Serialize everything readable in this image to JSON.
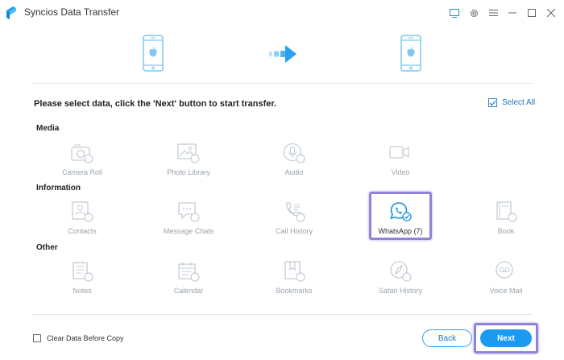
{
  "window": {
    "title": "Syncios Data Transfer",
    "accent_color": "#1a9af0",
    "highlight_color": "#9184d8"
  },
  "header_icons": [
    "feedback-icon",
    "gear-icon",
    "menu-icon",
    "minimize-icon",
    "maximize-icon",
    "close-icon"
  ],
  "instruction": "Please select data, click the 'Next' button to start transfer.",
  "select_all_label": "Select All",
  "sections": {
    "media": {
      "title": "Media",
      "items": [
        {
          "label": "Camera Roll",
          "icon": "camera-icon"
        },
        {
          "label": "Photo Library",
          "icon": "photo-icon"
        },
        {
          "label": "Audio",
          "icon": "microphone-icon"
        },
        {
          "label": "Video",
          "icon": "video-camera-icon"
        }
      ]
    },
    "information": {
      "title": "Information",
      "items": [
        {
          "label": "Contacts",
          "icon": "contacts-icon"
        },
        {
          "label": "Message Chats",
          "icon": "message-icon"
        },
        {
          "label": "Call History",
          "icon": "phone-icon"
        },
        {
          "label": "WhatsApp (7)",
          "icon": "whatsapp-icon"
        },
        {
          "label": "Book",
          "icon": "book-icon"
        }
      ]
    },
    "other": {
      "title": "Other",
      "items": [
        {
          "label": "Notes",
          "icon": "notes-icon"
        },
        {
          "label": "Calendar",
          "icon": "calendar-icon"
        },
        {
          "label": "Bookmarks",
          "icon": "bookmark-icon"
        },
        {
          "label": "Safari History",
          "icon": "compass-icon"
        },
        {
          "label": "Voice Mail",
          "icon": "voicemail-icon"
        }
      ]
    }
  },
  "clear_data_label": "Clear Data Before Copy",
  "back_label": "Back",
  "next_label": "Next"
}
